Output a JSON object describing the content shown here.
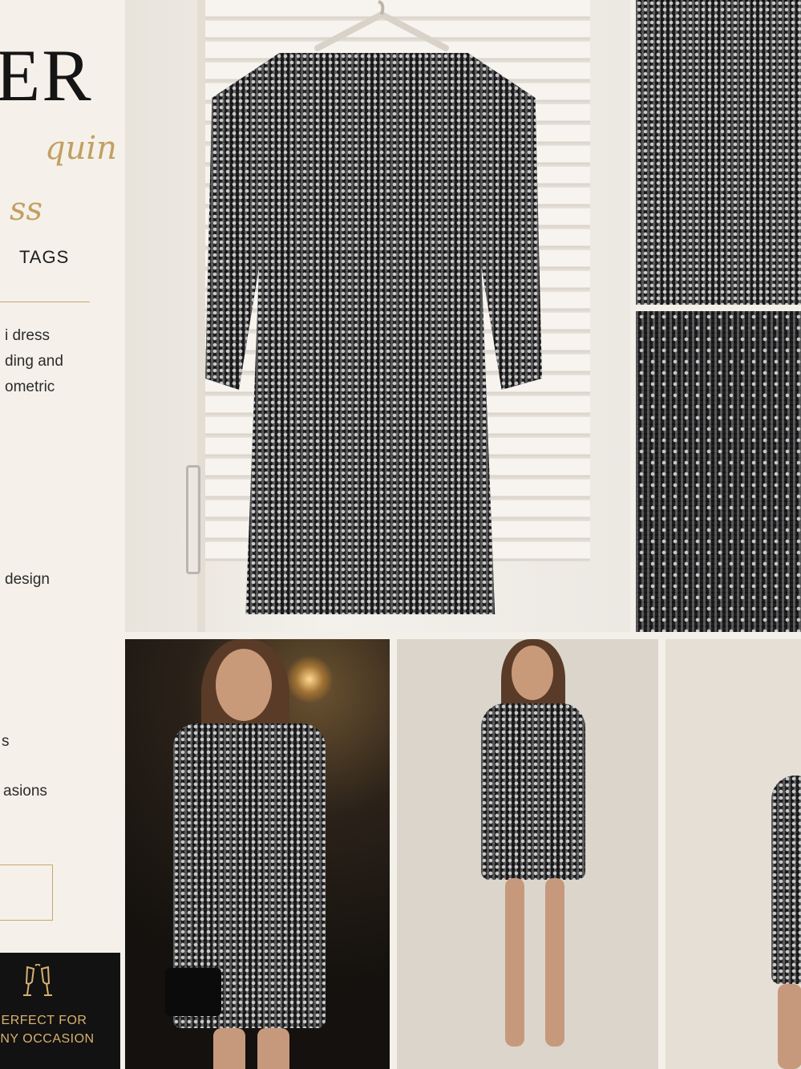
{
  "listing": {
    "brand_fragment": "ER",
    "script_line_1": "quin",
    "script_line_2": "ss",
    "tags_fragment": "TAGS",
    "description_lines": [
      "i dress",
      "ding and",
      "ometric"
    ],
    "feature_1": "design",
    "feature_2": "s",
    "feature_3": "asions"
  },
  "badge": {
    "icon": "champagne-glasses-icon",
    "line_1": "ERFECT FOR",
    "line_2": "NY OCCASION"
  },
  "colors": {
    "accent_gold": "#c9a66b",
    "badge_bg": "#121212",
    "panel_bg": "#f5f1ea"
  }
}
